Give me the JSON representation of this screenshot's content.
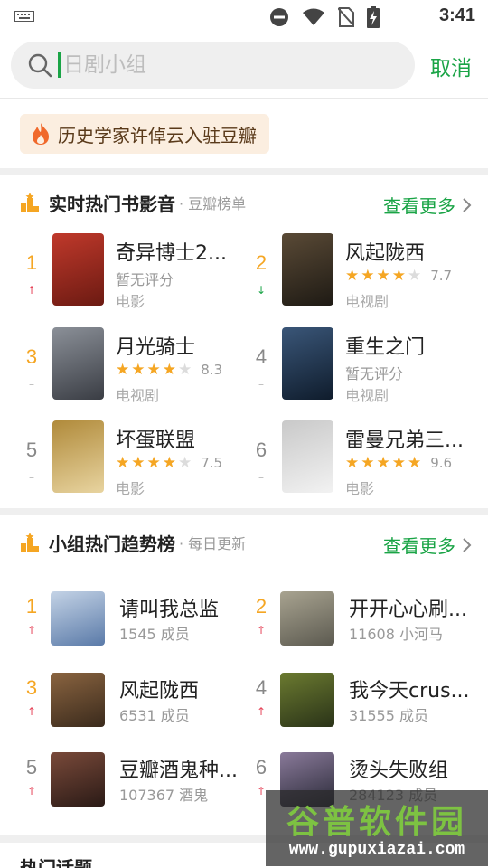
{
  "status_bar": {
    "time": "3:41"
  },
  "search": {
    "placeholder": "日剧小组",
    "cancel_label": "取消"
  },
  "promo": {
    "text": "历史学家许倬云入驻豆瓣"
  },
  "hot_media": {
    "title": "实时热门书影音",
    "subtitle": "· 豆瓣榜单",
    "more_label": "查看更多",
    "items": [
      {
        "rank": "1",
        "trend": "up",
        "title": "奇异博士2...",
        "rating_text": "暂无评分",
        "stars": 0,
        "score": "",
        "type": "电影",
        "poster": [
          "#6b1a12",
          "#c0392b"
        ]
      },
      {
        "rank": "2",
        "trend": "down",
        "title": "风起陇西",
        "rating_text": "",
        "stars": 4,
        "score": "7.7",
        "type": "电视剧",
        "poster": [
          "#1e1a14",
          "#5a4a36"
        ]
      },
      {
        "rank": "3",
        "trend": "flat",
        "title": "月光骑士",
        "rating_text": "",
        "stars": 4,
        "score": "8.3",
        "type": "电视剧",
        "poster": [
          "#3a3d44",
          "#8b9098"
        ]
      },
      {
        "rank": "4",
        "trend": "flat",
        "title": "重生之门",
        "rating_text": "暂无评分",
        "stars": 0,
        "score": "",
        "type": "电视剧",
        "poster": [
          "#0f1c2c",
          "#3a5678"
        ]
      },
      {
        "rank": "5",
        "trend": "flat",
        "title": "坏蛋联盟",
        "rating_text": "",
        "stars": 4,
        "score": "7.5",
        "type": "电影",
        "poster": [
          "#e8d4a0",
          "#b08a3a"
        ]
      },
      {
        "rank": "6",
        "trend": "flat",
        "title": "雷曼兄弟三...",
        "rating_text": "",
        "stars": 5,
        "score": "9.6",
        "type": "电影",
        "poster": [
          "#f2f2f2",
          "#c9c9c9"
        ]
      }
    ]
  },
  "hot_groups": {
    "title": "小组热门趋势榜",
    "subtitle": "· 每日更新",
    "more_label": "查看更多",
    "items": [
      {
        "rank": "1",
        "title": "请叫我总监",
        "meta": "1545 成员",
        "poster": [
          "#5a7aa8",
          "#c4d3e6"
        ]
      },
      {
        "rank": "2",
        "title": "开开心心刷...",
        "meta": "11608 小河马",
        "poster": [
          "#5c5a50",
          "#a8a390"
        ]
      },
      {
        "rank": "3",
        "title": "风起陇西",
        "meta": "6531 成员",
        "poster": [
          "#3a2a1c",
          "#8a6440"
        ]
      },
      {
        "rank": "4",
        "title": "我今天crus...",
        "meta": "31555 成员",
        "poster": [
          "#2a3318",
          "#6b7a30"
        ]
      },
      {
        "rank": "5",
        "title": "豆瓣酒鬼种...",
        "meta": "107367 酒鬼",
        "poster": [
          "#2a1a16",
          "#7a4a3a"
        ]
      },
      {
        "rank": "6",
        "title": "烫头失败组",
        "meta": "284123 成员",
        "poster": [
          "#2a2a38",
          "#8a7a9a"
        ]
      }
    ]
  },
  "bottom": {
    "title": "热门话题"
  },
  "watermark": {
    "brand": "谷普软件园",
    "url": "www.gupuxiazai.com"
  },
  "colors": {
    "accent": "#1aa446",
    "gold": "#f5a623",
    "up": "#e6455a"
  }
}
